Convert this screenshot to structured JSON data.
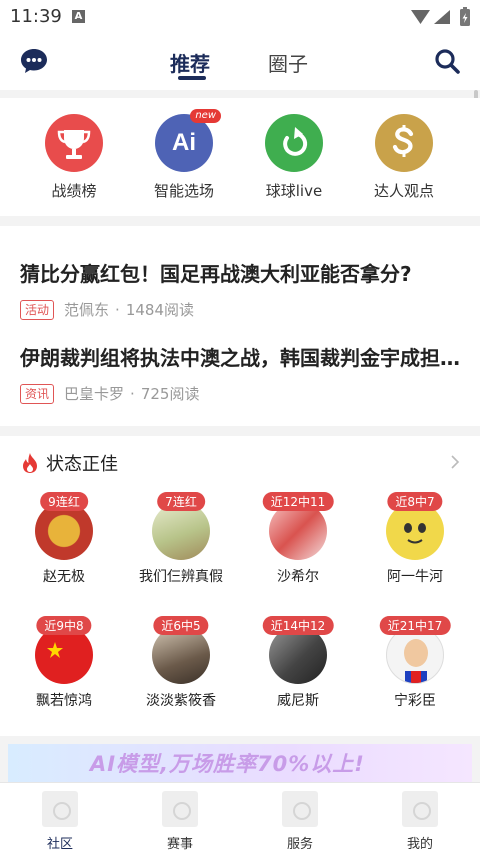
{
  "status_bar": {
    "time": "11:39",
    "notification_glyph": "A"
  },
  "header": {
    "tabs": [
      {
        "label": "推荐",
        "active": true
      },
      {
        "label": "圈子",
        "active": false
      }
    ]
  },
  "quick_links": [
    {
      "label": "战绩榜",
      "icon": "trophy-icon",
      "color": "#e84c4c"
    },
    {
      "label": "智能选场",
      "icon": "ai-icon",
      "color": "#4e63b5",
      "badge": "new",
      "icon_text": "Ai"
    },
    {
      "label": "球球live",
      "icon": "refresh-arrow-icon",
      "color": "#3fae4f"
    },
    {
      "label": "达人观点",
      "icon": "dollar-s-icon",
      "color": "#c9a24a"
    }
  ],
  "news": [
    {
      "title": "猜比分赢红包！国足再战澳大利亚能否拿分?",
      "tag": "活动",
      "author": "范佩东",
      "reads": "1484阅读"
    },
    {
      "title": "伊朗裁判组将执法中澳之战，韩国裁判金宇成担任第四官员",
      "tag": "资讯",
      "author": "巴皇卡罗",
      "reads": "725阅读"
    }
  ],
  "form_section": {
    "title": "状态正佳",
    "people": [
      {
        "name": "赵无极",
        "badge": "9连红",
        "avatar_color": "#c0392b"
      },
      {
        "name": "我们仨辨真假",
        "badge": "7连红",
        "avatar_color": "#b8c48a"
      },
      {
        "name": "沙希尔",
        "badge": "近12中11",
        "avatar_color": "#d9534f"
      },
      {
        "name": "阿一牛河",
        "badge": "近8中7",
        "avatar_color": "#f1d84a"
      },
      {
        "name": "飘若惊鸿",
        "badge": "近9中8",
        "avatar_color": "#e02020"
      },
      {
        "name": "淡淡紫筱香",
        "badge": "近6中5",
        "avatar_color": "#6b5a4a"
      },
      {
        "name": "威尼斯",
        "badge": "近14中12",
        "avatar_color": "#555555"
      },
      {
        "name": "宁彩臣",
        "badge": "近21中17",
        "avatar_color": "#f0c8a0"
      }
    ]
  },
  "banner": {
    "text": "AI模型,万场胜率70%以上!"
  },
  "bottom_nav": [
    {
      "label": "社区",
      "active": true
    },
    {
      "label": "赛事",
      "active": false
    },
    {
      "label": "服务",
      "active": false
    },
    {
      "label": "我的",
      "active": false
    }
  ]
}
